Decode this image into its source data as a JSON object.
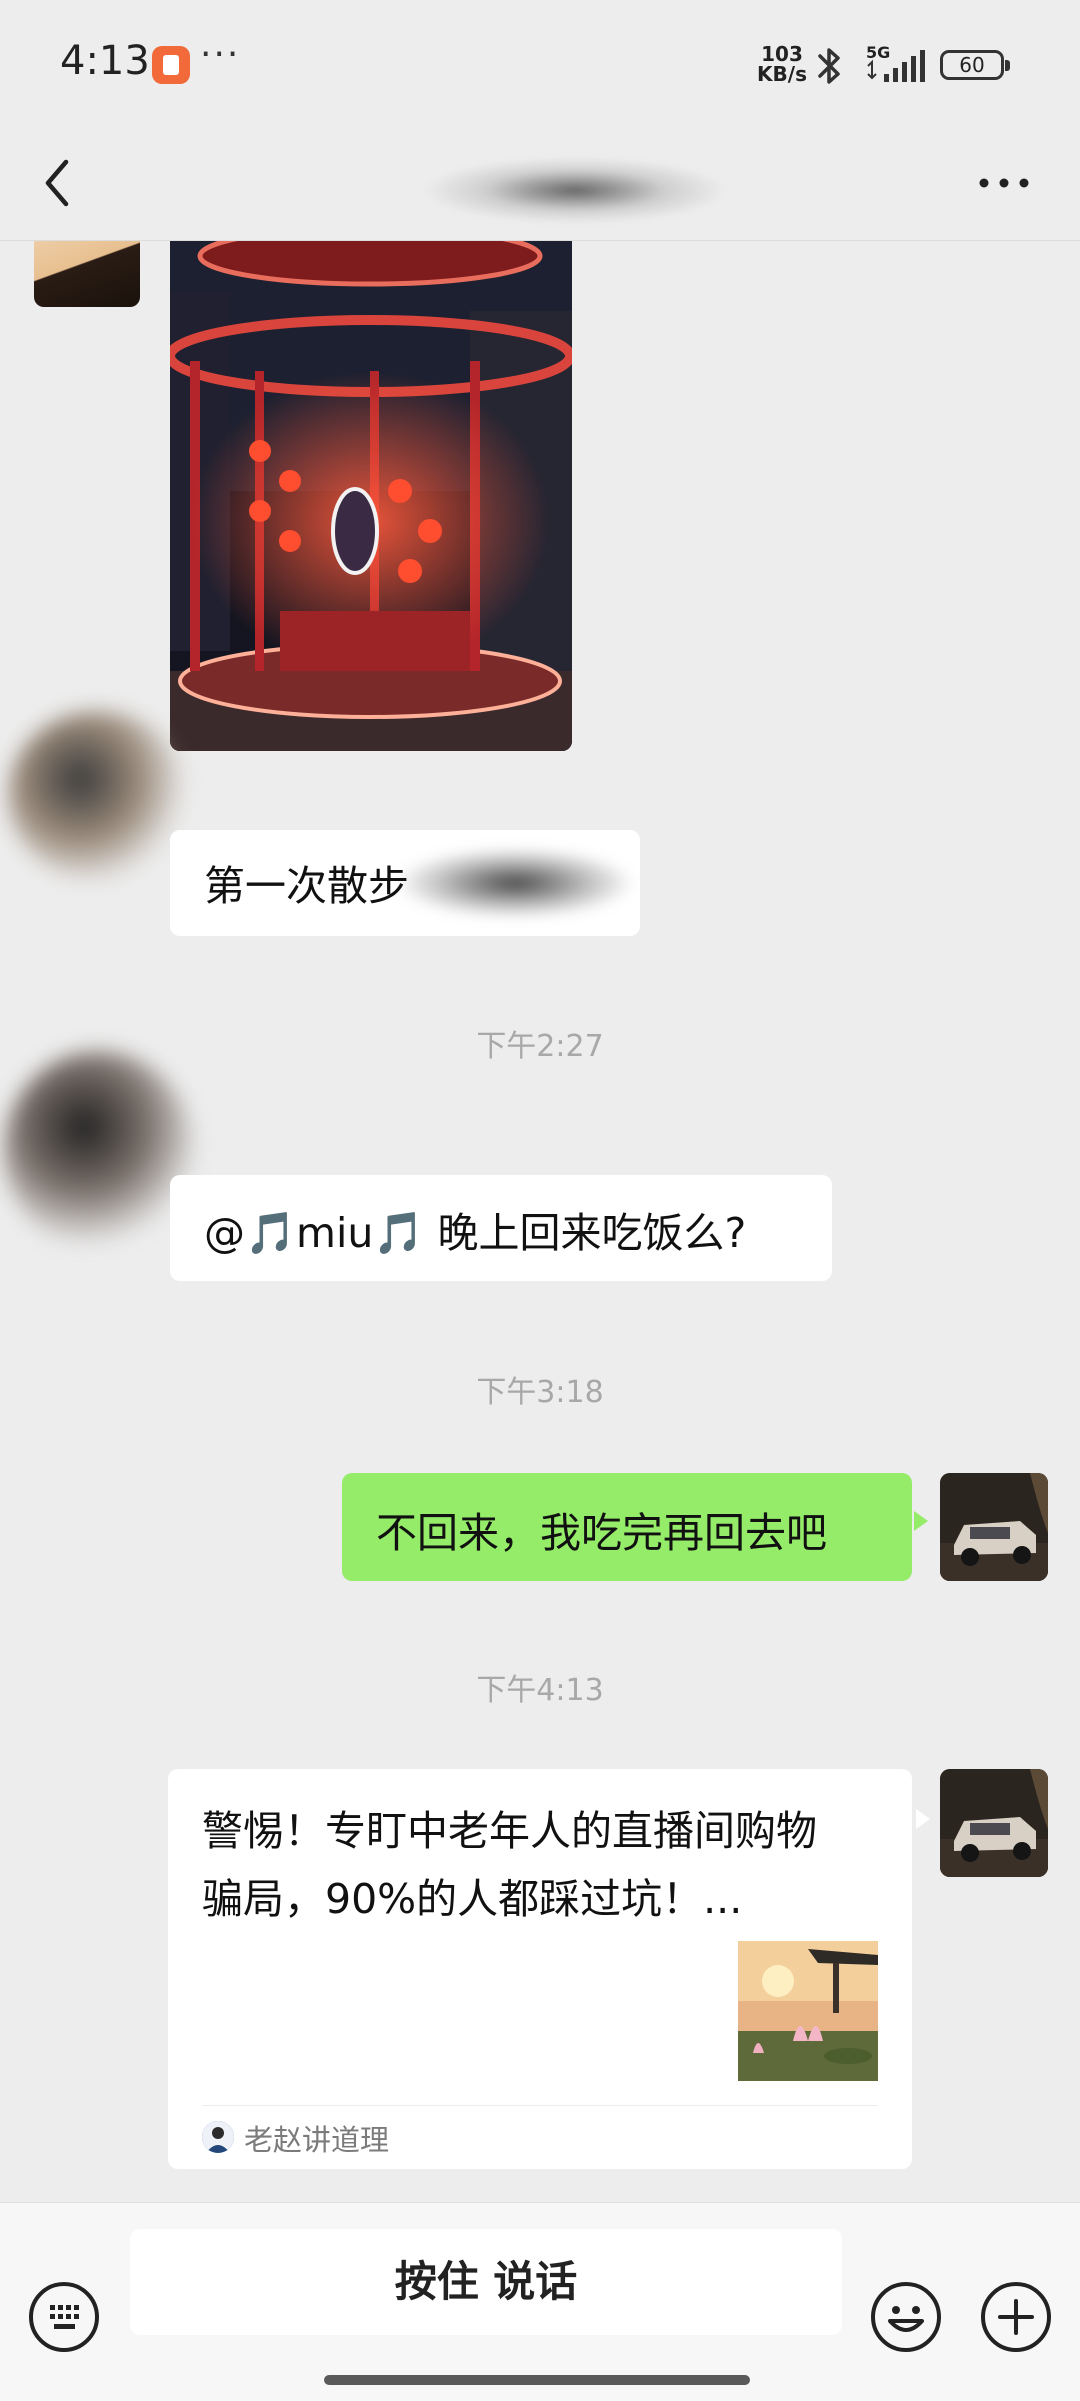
{
  "status_bar": {
    "time": "4:13",
    "more": "···",
    "net_speed_value": "103",
    "net_speed_unit": "KB/s",
    "network": "5G",
    "battery": "60",
    "icons": [
      "orange-app-icon",
      "bluetooth-icon",
      "signal-icon",
      "battery-icon"
    ]
  },
  "header": {
    "back_icon": "chevron-left-icon",
    "title": "",
    "menu_icon": "more-horizontal-icon"
  },
  "messages": [
    {
      "type": "image",
      "side": "left",
      "description_icon": "photo-message"
    },
    {
      "type": "text",
      "side": "left",
      "text": "第一次散步"
    },
    {
      "type": "time",
      "text": "下午2:27"
    },
    {
      "type": "text",
      "side": "left",
      "text": "@🎵miu🎵  晚上回来吃饭么?"
    },
    {
      "type": "time",
      "text": "下午3:18"
    },
    {
      "type": "text",
      "side": "right",
      "text": "不回来，我吃完再回去吧"
    },
    {
      "type": "time",
      "text": "下午4:13"
    },
    {
      "type": "article",
      "side": "right",
      "title": "警惕！专盯中老年人的直播间购物骗局，90%的人都踩过坑！...",
      "source": "老赵讲道理"
    }
  ],
  "input_bar": {
    "keyboard_icon": "keyboard-icon",
    "voice_label": "按住 说话",
    "emoji_icon": "emoji-icon",
    "plus_icon": "plus-icon"
  },
  "colors": {
    "background": "#ededed",
    "outgoing_bubble": "#95ec69",
    "incoming_bubble": "#ffffff",
    "timestamp": "#a8a8a8",
    "app_icon": "#f26a3a"
  }
}
